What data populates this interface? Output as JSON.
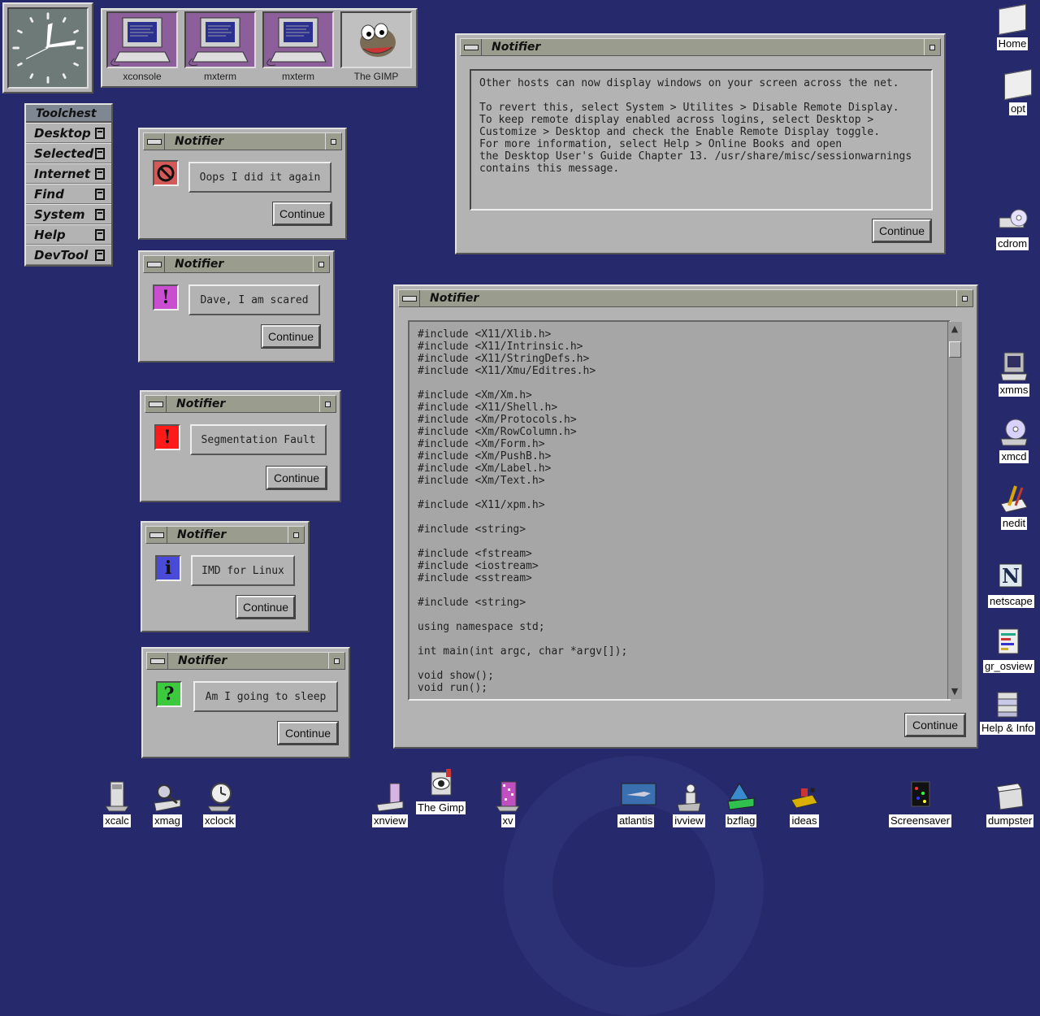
{
  "colors": {
    "desktop": "#26296b",
    "window": "#b3b3b3",
    "titlebar": "#9a9d8e",
    "icon_stop": "#d45a5a",
    "icon_warning_magenta": "#c94fd0",
    "icon_error_red": "#ff1a1a",
    "icon_info_blue": "#4a4ad9",
    "icon_question_green": "#3dc93d"
  },
  "launcher": {
    "items": [
      {
        "label": "xconsole",
        "icon": "computer-icon"
      },
      {
        "label": "mxterm",
        "icon": "computer-icon"
      },
      {
        "label": "mxterm",
        "icon": "computer-icon"
      },
      {
        "label": "The GIMP",
        "icon": "gimp-icon"
      }
    ]
  },
  "toolchest": {
    "title": "Toolchest",
    "items": [
      "Desktop",
      "Selected",
      "Internet",
      "Find",
      "System",
      "Help",
      "DevTool"
    ]
  },
  "dialogs": {
    "oops": {
      "title": "Notifier",
      "icon": "stop-icon",
      "message": "Oops I did it again",
      "button": "Continue"
    },
    "dave": {
      "title": "Notifier",
      "icon": "exclamation-icon",
      "message": "Dave, I am scared",
      "button": "Continue"
    },
    "segfault": {
      "title": "Notifier",
      "icon": "exclamation-icon",
      "message": "Segmentation Fault",
      "button": "Continue"
    },
    "imd": {
      "title": "Notifier",
      "icon": "info-icon",
      "message": "IMD for Linux",
      "button": "Continue"
    },
    "sleep": {
      "title": "Notifier",
      "icon": "question-icon",
      "message": "Am I going to sleep",
      "button": "Continue"
    },
    "remote": {
      "title": "Notifier",
      "text": "Other hosts can now display windows on your screen across the net.\n\nTo revert this, select System > Utilites > Disable Remote Display.\nTo keep remote display enabled across logins, select Desktop >\nCustomize > Desktop and check the Enable Remote Display toggle.\nFor more information, select Help > Online Books and open\nthe Desktop User's Guide Chapter 13. /usr/share/misc/sessionwarnings\ncontains this message.",
      "button": "Continue"
    },
    "code": {
      "title": "Notifier",
      "text": "#include <X11/Xlib.h>\n#include <X11/Intrinsic.h>\n#include <X11/StringDefs.h>\n#include <X11/Xmu/Editres.h>\n\n#include <Xm/Xm.h>\n#include <X11/Shell.h>\n#include <Xm/Protocols.h>\n#include <Xm/RowColumn.h>\n#include <Xm/Form.h>\n#include <Xm/PushB.h>\n#include <Xm/Label.h>\n#include <Xm/Text.h>\n\n#include <X11/xpm.h>\n\n#include <string>\n\n#include <fstream>\n#include <iostream>\n#include <sstream>\n\n#include <string>\n\nusing namespace std;\n\nint main(int argc, char *argv[]);\n\nvoid show();\nvoid run();",
      "button": "Continue"
    }
  },
  "desktop_icons_right": [
    {
      "label": "Home",
      "icon": "folder-icon"
    },
    {
      "label": "opt",
      "icon": "folder-icon"
    },
    {
      "label": "cdrom",
      "icon": "cdrom-icon"
    },
    {
      "label": "xmms",
      "icon": "xmms-icon"
    },
    {
      "label": "xmcd",
      "icon": "xmcd-icon"
    },
    {
      "label": "nedit",
      "icon": "nedit-icon"
    },
    {
      "label": "netscape",
      "icon": "netscape-icon"
    },
    {
      "label": "gr_osview",
      "icon": "osview-icon"
    },
    {
      "label": "Help & Info",
      "icon": "help-books-icon"
    }
  ],
  "desktop_icons_bottom": [
    {
      "label": "xcalc",
      "icon": "calculator-icon"
    },
    {
      "label": "xmag",
      "icon": "magnifier-icon"
    },
    {
      "label": "xclock",
      "icon": "clock-icon"
    },
    {
      "label": "xnview",
      "icon": "xnview-icon"
    },
    {
      "label": "The Gimp",
      "icon": "gimp-eye-icon"
    },
    {
      "label": "xv",
      "icon": "xv-icon"
    },
    {
      "label": "atlantis",
      "icon": "atlantis-icon"
    },
    {
      "label": "ivview",
      "icon": "ivview-icon"
    },
    {
      "label": "bzflag",
      "icon": "bzflag-icon"
    },
    {
      "label": "ideas",
      "icon": "ideas-icon"
    },
    {
      "label": "Screensaver",
      "icon": "screensaver-icon"
    },
    {
      "label": "dumpster",
      "icon": "dumpster-icon"
    }
  ]
}
